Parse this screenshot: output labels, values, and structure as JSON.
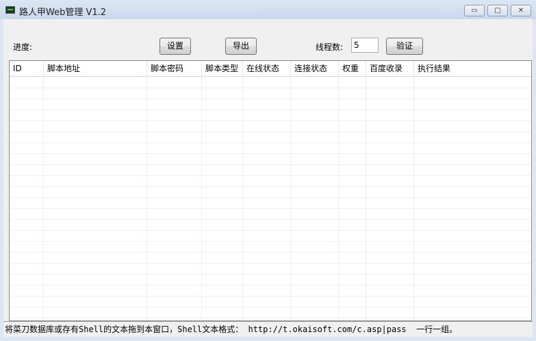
{
  "window": {
    "title": "路人甲Web管理 V1.2",
    "minimize": "▭",
    "maximize": "□",
    "close": "✕"
  },
  "toolbar": {
    "progress_label": "进度:",
    "settings_label": "设置",
    "export_label": "导出",
    "threads_label": "线程数:",
    "threads_value": "5",
    "verify_label": "验证"
  },
  "table": {
    "columns": [
      "ID",
      "脚本地址",
      "脚本密码",
      "脚本类型",
      "在线状态",
      "连接状态",
      "权重",
      "百度收录",
      "执行结果"
    ],
    "rows": []
  },
  "status": {
    "text": "将菜刀数据库或存有Shell的文本拖到本窗口，Shell文本格式： http://t.okaisoft.com/c.asp|pass  一行一组。"
  }
}
